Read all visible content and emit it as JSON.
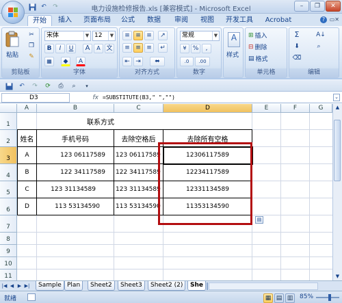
{
  "titlebar": {
    "title": "电力设施检修报告.xls  [兼容模式] - Microsoft Excel",
    "win_min": "–",
    "win_max": "❐",
    "win_close": "✕"
  },
  "tabs": [
    "开始",
    "插入",
    "页面布局",
    "公式",
    "数据",
    "审阅",
    "视图",
    "开发工具",
    "Acrobat"
  ],
  "active_tab": 0,
  "ribbon": {
    "clipboard": {
      "label": "剪贴板",
      "paste": "粘贴"
    },
    "font": {
      "label": "字体",
      "name": "宋体",
      "size": "12",
      "bold": "B",
      "italic": "I",
      "underline": "U",
      "grow": "A",
      "shrink": "A",
      "color_a": "A",
      "wen": "文",
      "highlight_color": "#ffff00",
      "font_color": "#ff0000"
    },
    "alignment": {
      "label": "对齐方式"
    },
    "number": {
      "label": "数字",
      "format": "常规",
      "pct": "%",
      "comma": ",",
      "inc": ".0",
      "dec": ".00"
    },
    "styles": {
      "label": "样式"
    },
    "cells": {
      "label": "单元格",
      "insert": "插入",
      "delete": "删除",
      "format": "格式"
    },
    "editing": {
      "label": "编辑",
      "sum": "Σ",
      "sort": "A↓",
      "find": "⌕"
    }
  },
  "formula_bar": {
    "name_box": "D3",
    "fx": "fx",
    "formula": "=SUBSTITUTE(B3,\" \",\"\")"
  },
  "columns": [
    "A",
    "B",
    "C",
    "D",
    "E",
    "F",
    "G"
  ],
  "rows": [
    "1",
    "2",
    "3",
    "4",
    "5",
    "6",
    "7",
    "8",
    "9",
    "10",
    "11"
  ],
  "selected_cell": {
    "col": "D",
    "row": "3"
  },
  "sheet": {
    "title": "联系方式",
    "headers": [
      "姓名",
      "手机号码",
      "去除空格后",
      "去除所有空格"
    ],
    "data": [
      {
        "name": "A",
        "phone": "123 06117589",
        "trimmed": "123 06117589",
        "nospace": "12306117589"
      },
      {
        "name": "B",
        "phone": "122 34117589",
        "trimmed": "122 34117589",
        "nospace": "12234117589"
      },
      {
        "name": "C",
        "phone": "123 31134589",
        "trimmed": "123 31134589",
        "nospace": "12331134589"
      },
      {
        "name": "D",
        "phone": "113 53134590",
        "trimmed": "113 53134590",
        "nospace": "11353134590"
      }
    ]
  },
  "sheet_tabs": [
    "Sample",
    "Plan",
    "Sheet2",
    "Sheet3",
    "Sheet2 (2)",
    "She"
  ],
  "active_sheet": 5,
  "status": {
    "ready": "就绪",
    "zoom": "85%"
  },
  "colors": {
    "highlight_box": "#b30d10",
    "selection": "#f1c15f"
  }
}
